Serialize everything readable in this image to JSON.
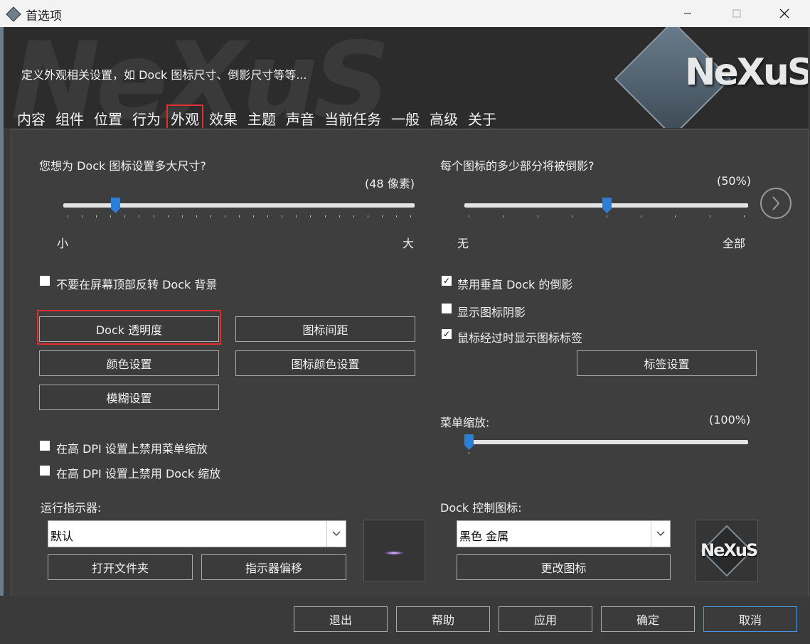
{
  "window": {
    "title": "首选项"
  },
  "header": {
    "description": "定义外观相关设置，如 Dock 图标尺寸、倒影尺寸等等...",
    "logo": "NeXuS",
    "watermark": "NeXuS"
  },
  "tabs": [
    {
      "label": "内容"
    },
    {
      "label": "组件"
    },
    {
      "label": "位置"
    },
    {
      "label": "行为"
    },
    {
      "label": "外观",
      "active": true
    },
    {
      "label": "效果"
    },
    {
      "label": "主题"
    },
    {
      "label": "声音"
    },
    {
      "label": "当前任务"
    },
    {
      "label": "一般"
    },
    {
      "label": "高级"
    },
    {
      "label": "关于"
    }
  ],
  "left": {
    "icon_size_question": "您想为 Dock 图标设置多大尺寸?",
    "icon_size_value": "(48 像素)",
    "icon_size_fraction": 0.14,
    "icon_size_min": "小",
    "icon_size_max": "大",
    "no_flip_label": "不要在屏幕顶部反转 Dock 背景",
    "no_flip_checked": false,
    "btn_transparency": "Dock 透明度",
    "btn_icon_spacing": "图标间距",
    "btn_color": "颜色设置",
    "btn_icon_color": "图标颜色设置",
    "btn_blur": "模糊设置",
    "dpi_menu_label": "在高 DPI 设置上禁用菜单缩放",
    "dpi_menu_checked": false,
    "dpi_dock_label": "在高 DPI 设置上禁用 Dock 缩放",
    "dpi_dock_checked": false,
    "indicator_label": "运行指示器:",
    "indicator_value": "默认",
    "btn_open_folder": "打开文件夹",
    "btn_indicator_offset": "指示器偏移"
  },
  "right": {
    "reflection_question": "每个图标的多少部分将被倒影?",
    "reflection_value": "(50%)",
    "reflection_fraction": 0.5,
    "reflection_min": "无",
    "reflection_max": "全部",
    "disable_vertical_label": "禁用垂直 Dock 的倒影",
    "disable_vertical_checked": true,
    "show_shadow_label": "显示图标阴影",
    "show_shadow_checked": false,
    "hover_label_label": "鼠标经过时显示图标标签",
    "hover_label_checked": true,
    "btn_label_settings": "标签设置",
    "menu_zoom_label": "菜单缩放:",
    "menu_zoom_value": "(100%)",
    "menu_zoom_fraction": 0.0,
    "dock_control_label": "Dock 控制图标:",
    "dock_control_value": "黑色 金属",
    "btn_change_icon": "更改图标",
    "preview_logo": "NeXuS"
  },
  "footer": {
    "exit": "退出",
    "help": "帮助",
    "apply": "应用",
    "ok": "确定",
    "cancel": "取消"
  },
  "colors": {
    "accent": "#2b7fd6",
    "highlight": "#e23030"
  }
}
